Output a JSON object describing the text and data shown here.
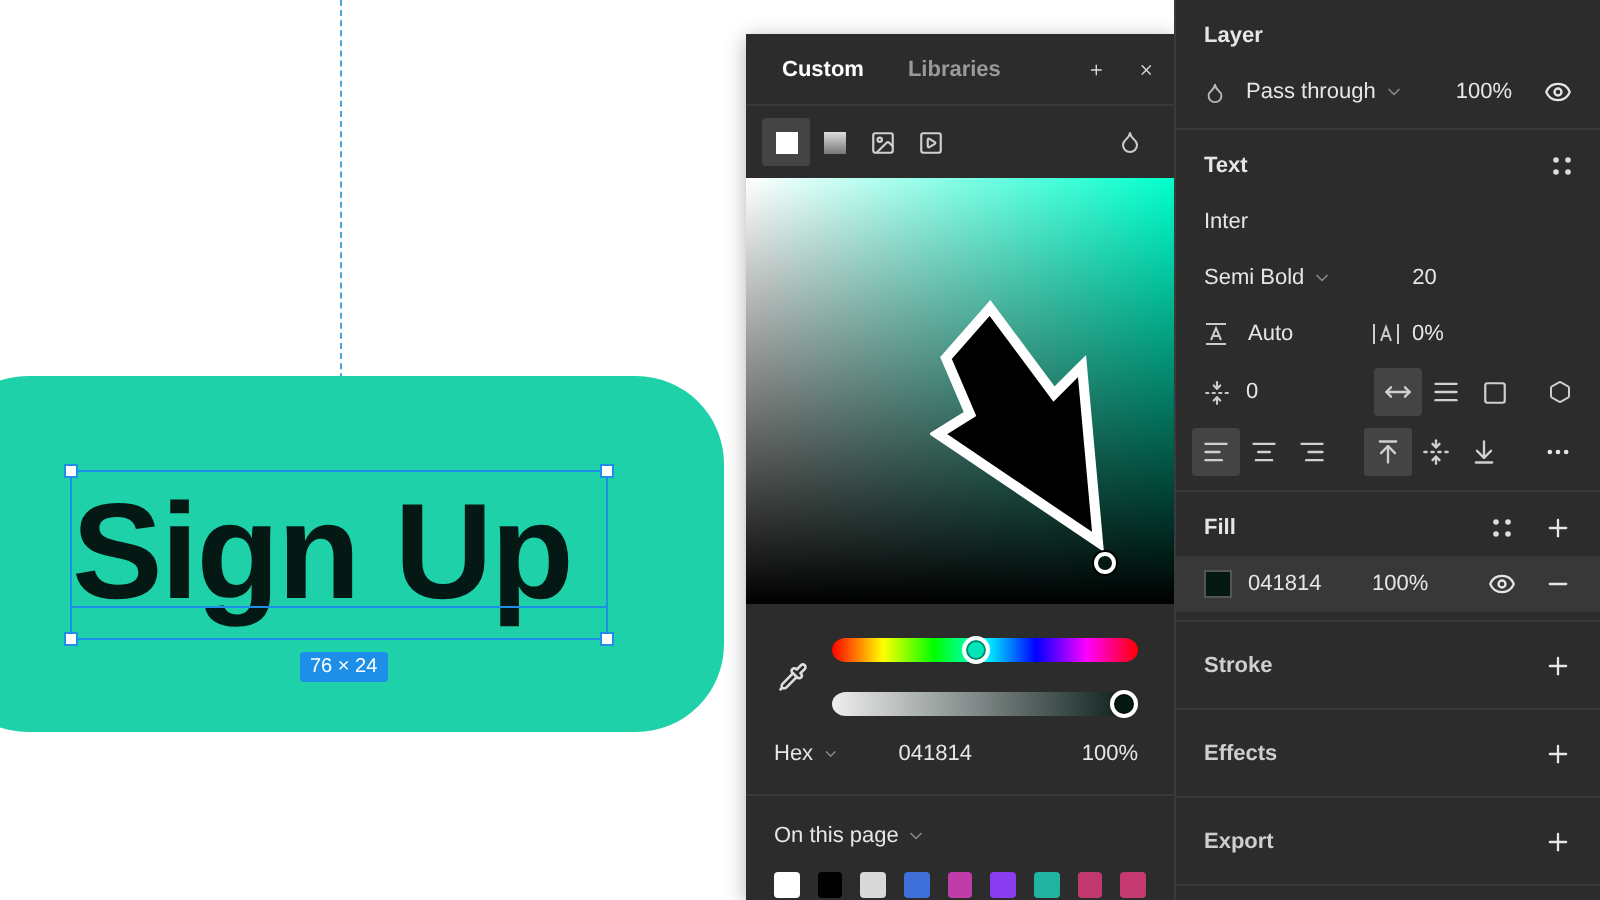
{
  "canvas": {
    "button_text": "Sign Up",
    "size_label": "76 × 24"
  },
  "color_picker": {
    "tabs": [
      {
        "label": "Custom",
        "selected": true
      },
      {
        "label": "Libraries",
        "selected": false
      }
    ],
    "fill_types": [
      {
        "kind": "solid",
        "selected": true
      },
      {
        "kind": "gradient",
        "selected": false
      },
      {
        "kind": "image",
        "selected": false
      },
      {
        "kind": "video",
        "selected": false
      }
    ],
    "hue": {
      "level": 0.47
    },
    "opacity_slider": {
      "level": 1
    },
    "format": "Hex",
    "hex": "041814",
    "opacity": "100%",
    "swatches_title": "On this page",
    "swatches": [
      {
        "color": "#ffffff"
      },
      {
        "color": "#000000"
      },
      {
        "color": "#d9d9d9"
      },
      {
        "color": "#3f6fd8"
      },
      {
        "color": "#c03ca8"
      },
      {
        "color": "#8a3df0"
      },
      {
        "color": "#1fb3a0"
      },
      {
        "color": "#c0386e"
      },
      {
        "color": "#c43a70"
      }
    ]
  },
  "layer": {
    "title": "Layer",
    "blend_mode": "Pass through",
    "opacity": "100%"
  },
  "text": {
    "title": "Text",
    "font": "Inter",
    "weight": "Semi Bold",
    "size": "20",
    "line_height": "Auto",
    "letter_spacing": "0%",
    "paragraph_spacing": "0",
    "resizing": [
      {
        "kind": "auto-width",
        "selected": true
      },
      {
        "kind": "auto-height",
        "selected": false
      },
      {
        "kind": "fixed",
        "selected": false
      }
    ],
    "align_horizontal": [
      {
        "kind": "left",
        "selected": true
      },
      {
        "kind": "center",
        "selected": false
      },
      {
        "kind": "right",
        "selected": false
      }
    ],
    "align_vertical": [
      {
        "kind": "top",
        "selected": true
      },
      {
        "kind": "middle",
        "selected": false
      },
      {
        "kind": "bottom",
        "selected": false
      }
    ]
  },
  "fill": {
    "title": "Fill",
    "hex": "041814",
    "opacity": "100%",
    "color": "#041814"
  },
  "sections": [
    {
      "title": "Stroke"
    },
    {
      "title": "Effects"
    },
    {
      "title": "Export"
    }
  ]
}
